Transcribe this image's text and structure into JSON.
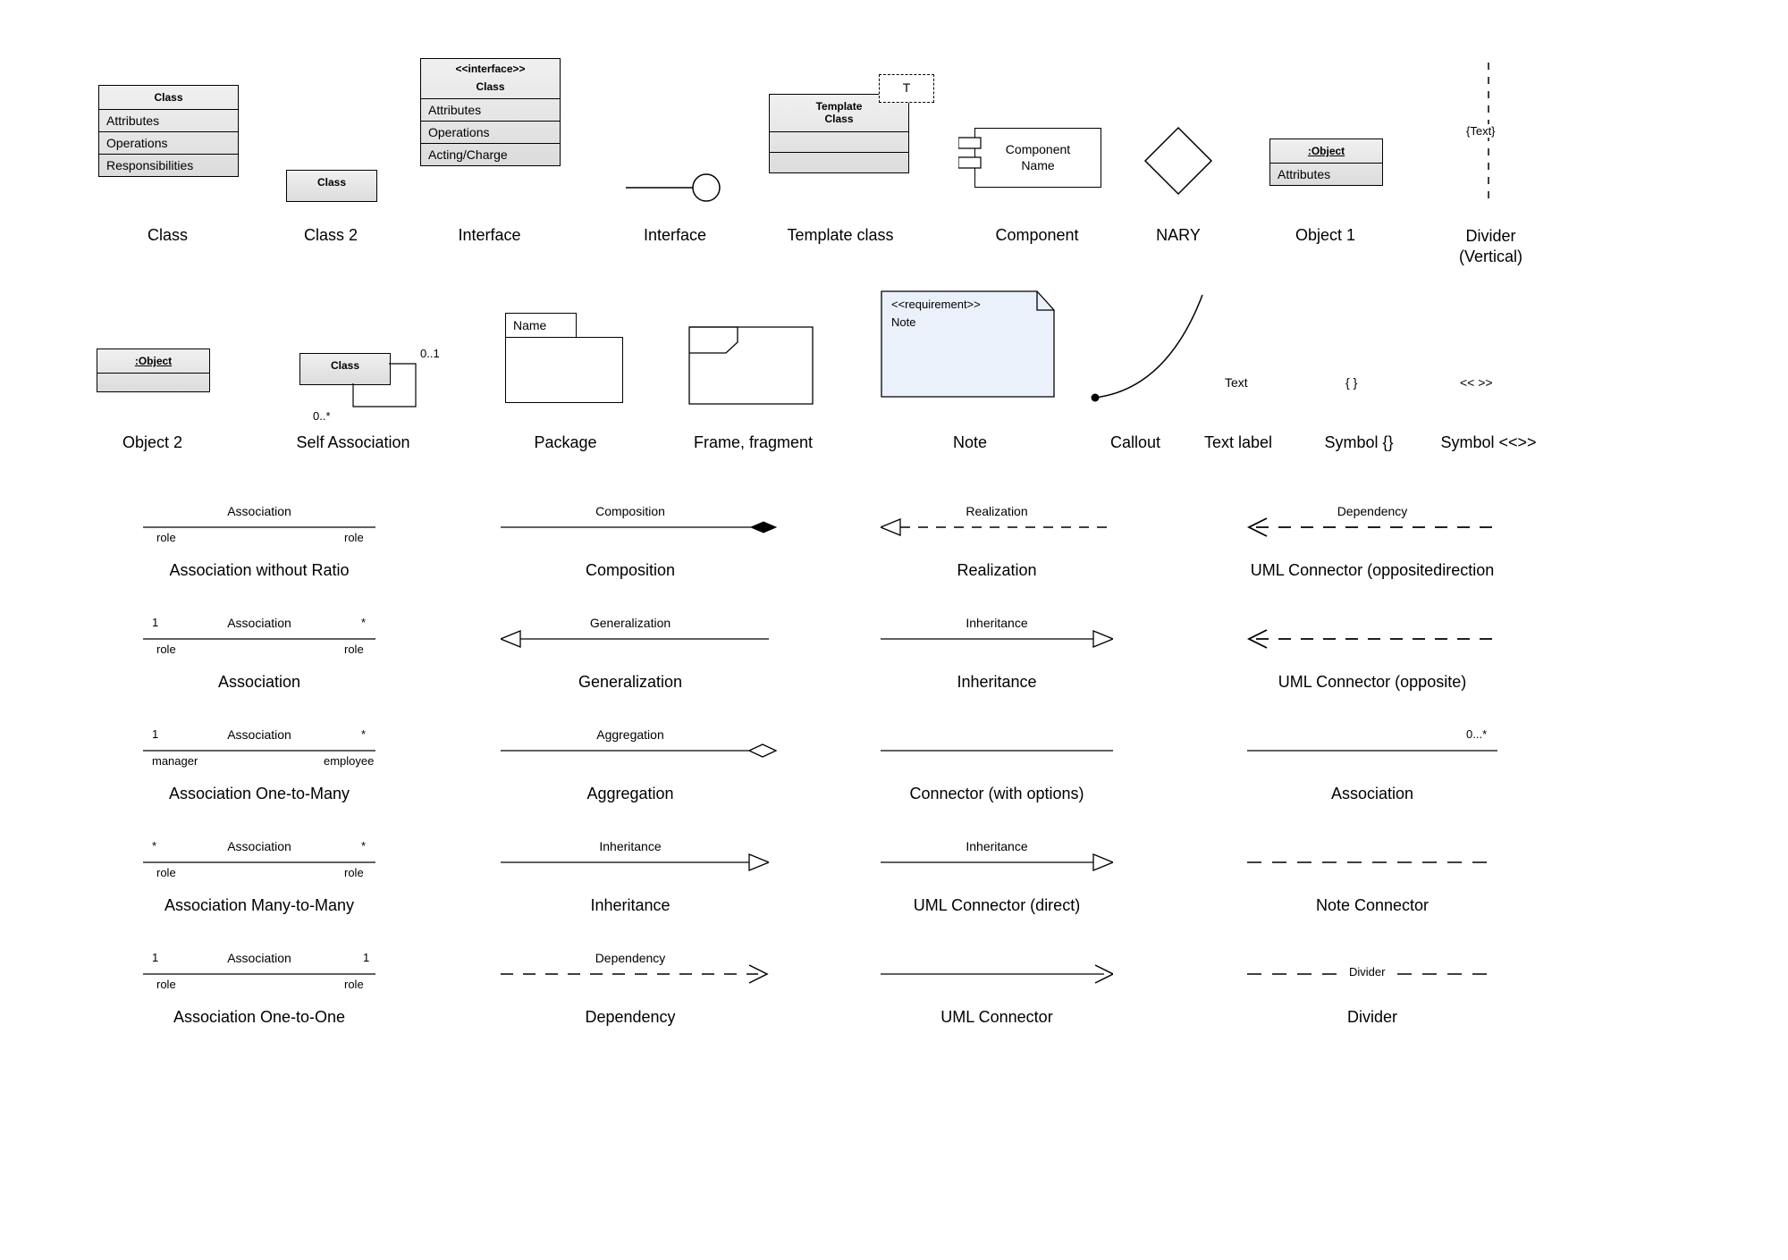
{
  "captions": {
    "class": "Class",
    "class2": "Class 2",
    "interface": "Interface",
    "interface2": "Interface",
    "template": "Template class",
    "component": "Component",
    "nary": "NARY",
    "object1": "Object 1",
    "divider_v": "Divider\n(Vertical)",
    "object2": "Object 2",
    "selfassoc": "Self Association",
    "package": "Package",
    "frame": "Frame, fragment",
    "note": "Note",
    "callout": "Callout",
    "textlabel": "Text label",
    "symbol_braces": "Symbol {}",
    "symbol_angles": "Symbol <<>>",
    "assoc_noratio": "Association without Ratio",
    "composition": "Composition",
    "realization": "Realization",
    "opp_dir": "UML Connector (oppositedirection",
    "assoc": "Association",
    "generalization": "Generalization",
    "inheritance": "Inheritance",
    "opp": "UML Connector (opposite)",
    "one_many": "Association One-to-Many",
    "aggregation": "Aggregation",
    "conn_opts": "Connector (with options)",
    "association2": "Association",
    "many_many": "Association Many-to-Many",
    "inheritance2": "Inheritance",
    "conn_direct": "UML Connector (direct)",
    "note_conn": "Note Connector",
    "one_one": "Association One-to-One",
    "dependency": "Dependency",
    "uml_conn": "UML Connector",
    "divider": "Divider"
  },
  "class_box": {
    "title": "Class",
    "attr": "Attributes",
    "ops": "Operations",
    "resp": "Responsibilities"
  },
  "class2_box": {
    "title": "Class"
  },
  "interface_box": {
    "stereo": "<<interface>>",
    "title": "Class",
    "attr": "Attributes",
    "ops": "Operations",
    "acting": "Acting/Charge"
  },
  "template_box": {
    "title": "Template\nClass",
    "T": "T"
  },
  "component_box": {
    "name": "Component\nName"
  },
  "object1_box": {
    "title": ":Object",
    "attr": "Attributes"
  },
  "divider_text": "{Text}",
  "object2_box": {
    "title": ":Object"
  },
  "self_box": {
    "title": "Class",
    "top": "0..1",
    "bot": "0..*"
  },
  "package_box": {
    "tab": "Name"
  },
  "note_box": {
    "stereo": "<<requirement>>",
    "body": "Note"
  },
  "textlabel_text": "Text",
  "braces": "{  }",
  "angles": "<<  >>",
  "conns": {
    "assoc": "Association",
    "role": "role",
    "one": "1",
    "star": "*",
    "mgr": "manager",
    "emp": "employee",
    "composition": "Composition",
    "realization": "Realization",
    "dependency": "Dependency",
    "generalization": "Generalization",
    "inheritance": "Inheritance",
    "aggregation": "Aggregation",
    "zero_star": "0...*",
    "divider": "Divider"
  }
}
